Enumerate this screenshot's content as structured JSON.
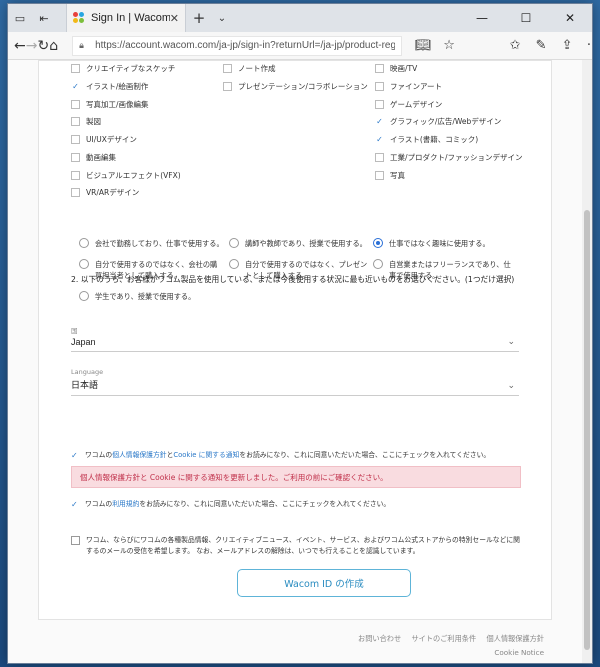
{
  "browser": {
    "tab_title": "Sign In | Wacom",
    "url": "https://account.wacom.com/ja-jp/sign-in?returnUrl=/ja-jp/product-registration#/welcome"
  },
  "interests": [
    {
      "label": "クリエイティブなスケッチ",
      "checked": false
    },
    {
      "label": "ノート作成",
      "checked": false
    },
    {
      "label": "映画/TV",
      "checked": false
    },
    {
      "label": "イラスト/絵画制作",
      "checked": true
    },
    {
      "label": "プレゼンテーション/コラボレーション",
      "checked": false
    },
    {
      "label": "ファインアート",
      "checked": false
    },
    {
      "label": "写真加工/画像編集",
      "checked": false
    },
    {
      "label": "",
      "checked": null
    },
    {
      "label": "ゲームデザイン",
      "checked": false
    },
    {
      "label": "製図",
      "checked": false
    },
    {
      "label": "",
      "checked": null
    },
    {
      "label": "グラフィック/広告/Webデザイン",
      "checked": true
    },
    {
      "label": "UI/UXデザイン",
      "checked": false
    },
    {
      "label": "",
      "checked": null
    },
    {
      "label": "イラスト(書籍、コミック)",
      "checked": true
    },
    {
      "label": "動画編集",
      "checked": false
    },
    {
      "label": "",
      "checked": null
    },
    {
      "label": "工業/プロダクト/ファッションデザイン",
      "checked": false
    },
    {
      "label": "ビジュアルエフェクト(VFX)",
      "checked": false
    },
    {
      "label": "",
      "checked": null
    },
    {
      "label": "写真",
      "checked": false
    },
    {
      "label": "VR/ARデザイン",
      "checked": false
    }
  ],
  "question2": {
    "text": "2. 以下のうち、お客様がワコム製品を使用している、または今後使用する状況に最も近いものをお選びください。(1つだけ選択)",
    "options": [
      {
        "label": "会社で勤務しており、仕事で使用する。",
        "selected": false
      },
      {
        "label": "講師や教師であり、授業で使用する。",
        "selected": false
      },
      {
        "label": "仕事ではなく趣味に使用する。",
        "selected": true
      },
      {
        "label": "自分で使用するのではなく、会社の購買担当者として購入する。",
        "selected": false
      },
      {
        "label": "自分で使用するのではなく、プレゼントとして購入する。",
        "selected": false
      },
      {
        "label": "自営業またはフリーランスであり、仕事で使用する。",
        "selected": false
      },
      {
        "label": "学生であり、授業で使用する。",
        "selected": false
      }
    ]
  },
  "country": {
    "label": "国",
    "value": "Japan"
  },
  "language": {
    "label": "Language",
    "value": "日本語"
  },
  "notice": "個人情報保護方針と Cookie に関する通知を更新しました。ご利用の前にご確認ください。",
  "consent1": {
    "pre": "ワコムの",
    "link1": "個人情報保護方針",
    "mid": "と",
    "link2": "Cookie に関する通知",
    "post": "をお読みになり、これに同意いただいた場合、ここにチェックを入れてください。"
  },
  "consent2": {
    "pre": "ワコムの",
    "link": "利用規約",
    "post": "をお読みになり、これに同意いただいた場合、ここにチェックを入れてください。"
  },
  "consent3": "ワコム、ならびにワコムの各種製品情報、クリエイティブニュース、イベント、サービス、およびワコム公式ストアからの特別セールなどに関するのメールの受信を希望します。 なお、メールアドレスの解除は、いつでも行えることを認識しています。",
  "create_button": "Wacom ID の作成",
  "footer": {
    "contact": "お問い合わせ",
    "terms": "サイトのご利用条件",
    "privacy": "個人情報保護方針",
    "cookie": "Cookie Notice"
  }
}
